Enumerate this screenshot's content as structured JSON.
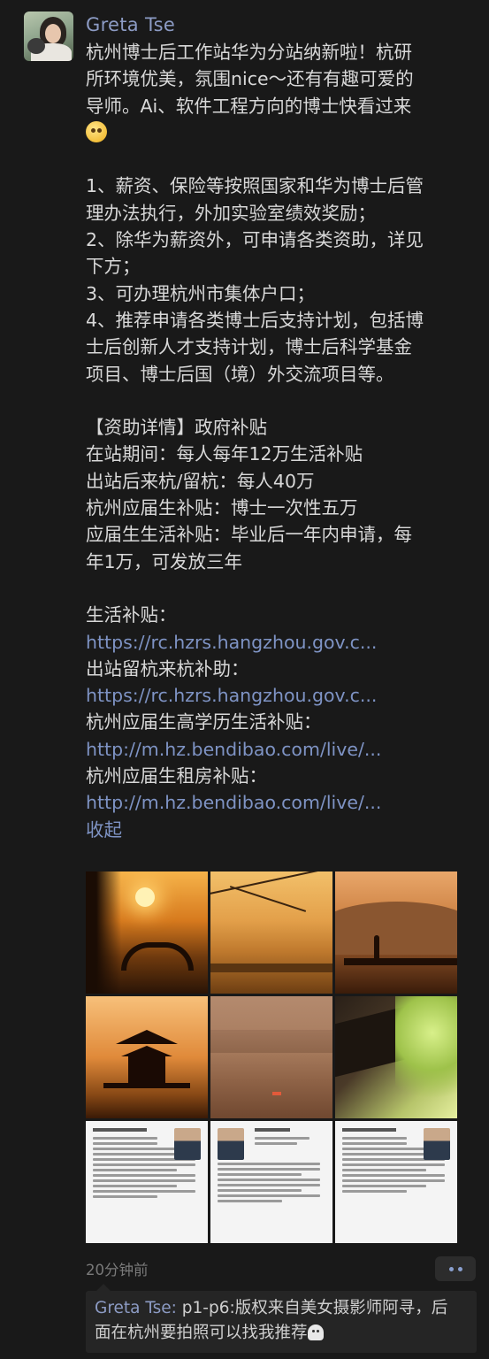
{
  "post": {
    "author": "Greta Tse",
    "intro_1": "杭州博士后工作站华为分站纳新啦！杭研",
    "intro_2": "所环境优美，氛围nice～还有有趣可爱的",
    "intro_3": "导师。Ai、软件工程方向的博士快看过来",
    "points": [
      [
        "1、薪资、保险等按照国家和华为博士后管",
        "理办法执行，外加实验室绩效奖励；"
      ],
      [
        "2、除华为薪资外，可申请各类资助，详见",
        "下方；"
      ],
      [
        "3、可办理杭州市集体户口；"
      ],
      [
        "4、推荐申请各类博士后支持计划，包括博",
        "士后创新人才支持计划，博士后科学基金",
        "项目、博士后国（境）外交流项目等。"
      ]
    ],
    "subsidy": {
      "header": "【资助详情】政府补贴",
      "lines": [
        "在站期间：每人每年12万生活补贴",
        "出站后来杭/留杭：每人40万",
        "杭州应届生补贴：博士一次性五万",
        "应届生生活补贴：毕业后一年内申请，每",
        "年1万，可发放三年"
      ]
    },
    "links": [
      {
        "label": "生活补贴：",
        "url": "https://rc.hzrs.hangzhou.gov.c..."
      },
      {
        "label": "出站留杭来杭补助：",
        "url": "https://rc.hzrs.hangzhou.gov.c..."
      },
      {
        "label": "杭州应届生高学历生活补贴：",
        "url": "http://m.hz.bendibao.com/live/..."
      },
      {
        "label": "杭州应届生租房补贴：",
        "url": "http://m.hz.bendibao.com/live/..."
      }
    ],
    "collapse_label": "收起",
    "timestamp": "20分钟前"
  },
  "comment": {
    "name": "Greta Tse",
    "separator": ":",
    "text_1": " p1-p6:版权来自美女摄影师阿寻，后",
    "text_2": "面在杭州要拍照可以找我推荐"
  },
  "colors": {
    "background": "#191919",
    "name_blue": "#8c9bc4",
    "link_blue": "#7e93c4",
    "text": "#d8d8d8"
  }
}
